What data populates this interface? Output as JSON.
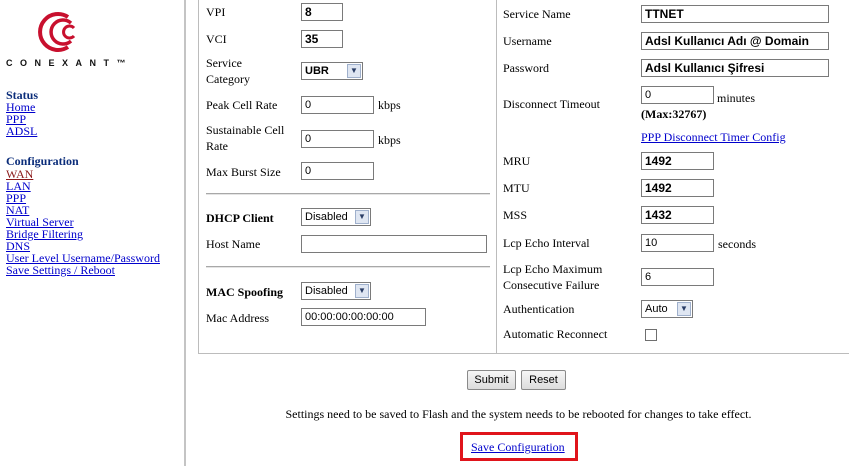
{
  "sidebar": {
    "brand": "CONEXANT™",
    "status_heading": "Status",
    "status_links": [
      "Home",
      "PPP",
      "ADSL"
    ],
    "config_heading": "Configuration",
    "config_links": [
      "WAN",
      "LAN",
      "PPP",
      "NAT",
      "Virtual Server",
      "Bridge Filtering",
      "DNS",
      "User Level Username/Password",
      "Save Settings / Reboot"
    ],
    "active_link": "WAN"
  },
  "left": {
    "vpi_label": "VPI",
    "vpi_value": "8",
    "vci_label": "VCI",
    "vci_value": "35",
    "service_category_label_1": "Service",
    "service_category_label_2": "Category",
    "service_category_value": "UBR",
    "peak_cell_rate_label": "Peak Cell Rate",
    "peak_cell_rate_value": "0",
    "peak_unit": "kbps",
    "sustainable_label_1": "Sustainable Cell",
    "sustainable_label_2": "Rate",
    "sustainable_value": "0",
    "sustainable_unit": "kbps",
    "max_burst_label": "Max Burst Size",
    "max_burst_value": "0",
    "dhcp_client_label": "DHCP Client",
    "dhcp_client_value": "Disabled",
    "host_name_label": "Host Name",
    "host_name_value": "",
    "mac_spoofing_label": "MAC Spoofing",
    "mac_spoofing_value": "Disabled",
    "mac_address_label": "Mac Address",
    "mac_address_value": "00:00:00:00:00:00"
  },
  "right": {
    "service_name_label": "Service Name",
    "service_name_value": "TTNET",
    "username_label": "Username",
    "username_value": "Adsl Kullanıcı Adı @ Domain",
    "password_label": "Password",
    "password_value": "Adsl Kullanıcı Şifresi",
    "disconnect_timeout_label": "Disconnect Timeout",
    "disconnect_timeout_value": "0",
    "minutes_unit": "minutes",
    "max_note": "(Max:32767)",
    "timer_config_link": "PPP Disconnect Timer Config",
    "mru_label": "MRU",
    "mru_value": "1492",
    "mtu_label": "MTU",
    "mtu_value": "1492",
    "mss_label": "MSS",
    "mss_value": "1432",
    "lcp_echo_interval_label": "Lcp Echo Interval",
    "lcp_echo_interval_value": "10",
    "seconds_unit": "seconds",
    "lcp_max_failure_label_1": "Lcp Echo Maximum",
    "lcp_max_failure_label_2": "Consecutive Failure",
    "lcp_max_failure_value": "6",
    "authentication_label": "Authentication",
    "authentication_value": "Auto",
    "auto_reconnect_label": "Automatic Reconnect"
  },
  "actions": {
    "submit_label": "Submit",
    "reset_label": "Reset",
    "note": "Settings need to be saved to Flash and the system needs to be rebooted for changes to take effect.",
    "save_configuration_label": "Save Configuration"
  },
  "colors": {
    "highlight_box": "#e0141b",
    "link": "#0000cc",
    "active_link": "#8b1a1a",
    "heading": "#0b2d7a"
  }
}
